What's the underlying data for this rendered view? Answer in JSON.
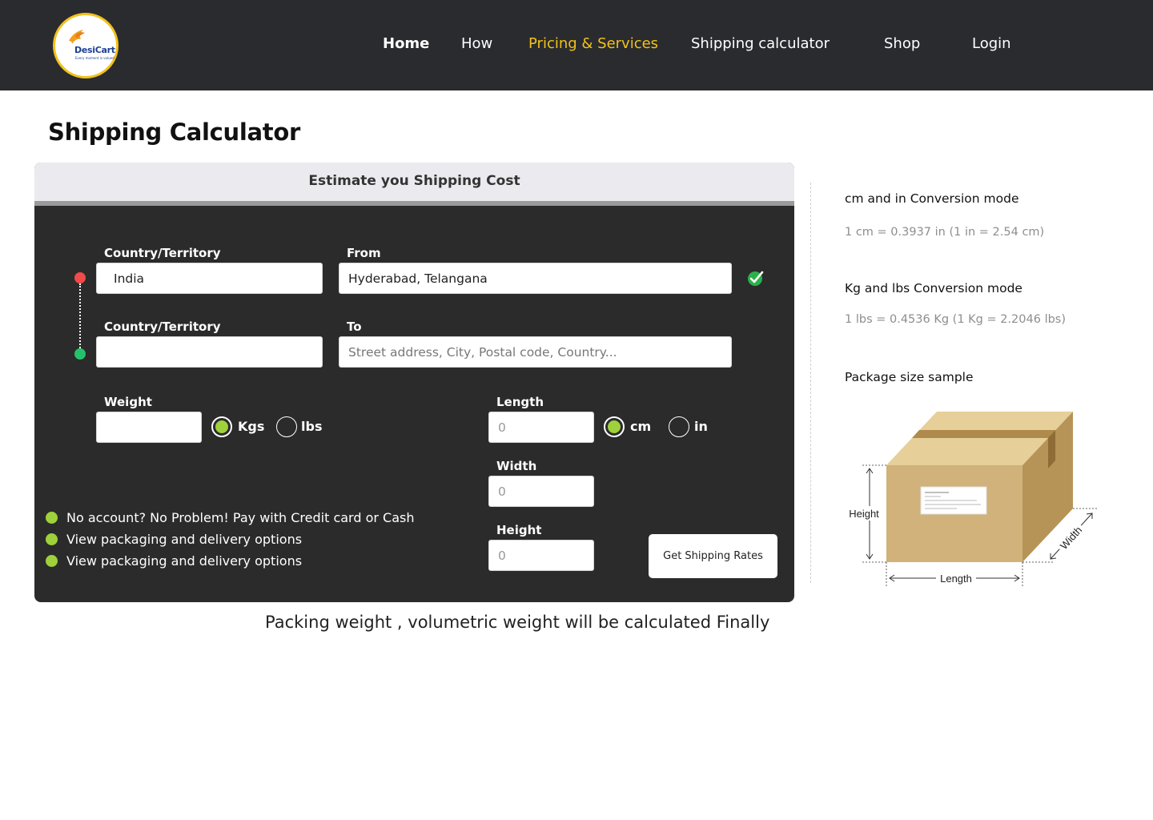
{
  "header": {
    "logo_text": "DesiCart",
    "logo_tagline": "Every moment is valued",
    "nav": [
      {
        "label": "Home"
      },
      {
        "label": "How"
      },
      {
        "label": "Pricing & Services"
      },
      {
        "label": "Shipping calculator"
      },
      {
        "label": "Shop"
      },
      {
        "label": "Login"
      }
    ],
    "colors": {
      "bar": "#2a2b2f",
      "active": "#f2c21b"
    }
  },
  "page_title": "Shipping Calculator",
  "calculator": {
    "heading": "Estimate you Shipping Cost",
    "origin": {
      "country_label": "Country/Territory",
      "country_value": "India",
      "from_label": "From",
      "from_value": "Hyderabad, Telangana",
      "verified_icon": "check-circle-icon"
    },
    "destination": {
      "country_label": "Country/Territory",
      "country_value": "",
      "to_label": "To",
      "to_placeholder": "Street address, City, Postal code, Country..."
    },
    "weight": {
      "label": "Weight",
      "value": "",
      "unit_options": [
        {
          "label": "Kgs",
          "selected": true
        },
        {
          "label": "lbs",
          "selected": false
        }
      ]
    },
    "dimensions": {
      "length_label": "Length",
      "length_placeholder": "0",
      "width_label": "Width",
      "width_placeholder": "0",
      "height_label": "Height",
      "height_placeholder": "0",
      "unit_options": [
        {
          "label": "cm",
          "selected": true
        },
        {
          "label": "in",
          "selected": false
        }
      ]
    },
    "bullets": [
      "No account? No Problem! Pay with Credit card or Cash",
      "View packaging and delivery options",
      "View packaging and delivery options"
    ],
    "submit_label": "Get Shipping Rates",
    "accent_color": "#9ed13b"
  },
  "note": "Packing weight , volumetric weight will be calculated Finally",
  "sidebar": {
    "cm_heading": "cm and in Conversion mode",
    "cm_text": "1 cm = 0.3937 in  (1 in = 2.54 cm)",
    "kg_heading": "Kg and lbs Conversion mode",
    "kg_text": "1 lbs = 0.4536 Kg  (1 Kg = 2.2046 lbs)",
    "sample_heading": "Package size sample",
    "sample_labels": {
      "height": "Height",
      "length": "Length",
      "width": "Width"
    }
  }
}
